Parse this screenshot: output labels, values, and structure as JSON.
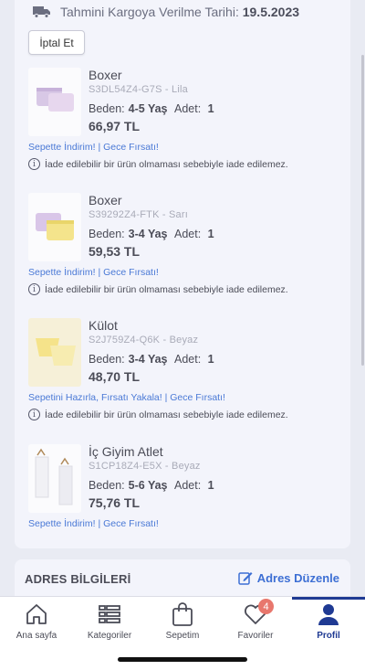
{
  "shipping": {
    "label": "Tahmini Kargoya Verilme Tarihi:",
    "date": "19.5.2023"
  },
  "cancel_label": "İptal Et",
  "size_label": "Beden:",
  "qty_label": "Adet:",
  "notice_text": "İade edilebilir bir ürün olmaması sebebiyle iade edilemez.",
  "items": [
    {
      "name": "Boxer",
      "code": "S3DL54Z4-G7S - Lila",
      "size": "4-5 Yaş",
      "qty": "1",
      "price": "66,97 TL",
      "promo": "Sepette İndirim! | Gece Fırsatı!",
      "colors": [
        "#d8c8e6",
        "#e7d7ee"
      ]
    },
    {
      "name": "Boxer",
      "code": "S39292Z4-FTK - Sarı",
      "size": "3-4 Yaş",
      "qty": "1",
      "price": "59,53 TL",
      "promo": "Sepette İndirim! | Gece Fırsatı!",
      "colors": [
        "#f4e48c",
        "#d9c6e8"
      ]
    },
    {
      "name": "Külot",
      "code": "S2J759Z4-Q6K - Beyaz",
      "size": "3-4 Yaş",
      "qty": "1",
      "price": "48,70 TL",
      "promo": "Sepetini Hazırla, Fırsatı Yakala! | Gece Fırsatı!",
      "colors": [
        "#f5e38a",
        "#f7ecb0"
      ]
    },
    {
      "name": "İç Giyim Atlet",
      "code": "S1CP18Z4-E5X - Beyaz",
      "size": "5-6 Yaş",
      "qty": "1",
      "price": "75,76 TL",
      "promo": "Sepette İndirim! | Gece Fırsatı!",
      "colors": [
        "#f6f6f8",
        "#e9e9ef"
      ]
    }
  ],
  "address": {
    "title": "ADRES BİLGİLERİ",
    "edit_label": "Adres Düzenle"
  },
  "tabs": [
    {
      "label": "Ana sayfa",
      "icon": "home-icon"
    },
    {
      "label": "Kategoriler",
      "icon": "list-icon"
    },
    {
      "label": "Sepetim",
      "icon": "bag-icon"
    },
    {
      "label": "Favoriler",
      "icon": "heart-icon",
      "badge": "4"
    },
    {
      "label": "Profil",
      "icon": "profile-icon",
      "active": true
    }
  ],
  "accent_color": "#1f3a93",
  "link_color": "#4a79d6"
}
